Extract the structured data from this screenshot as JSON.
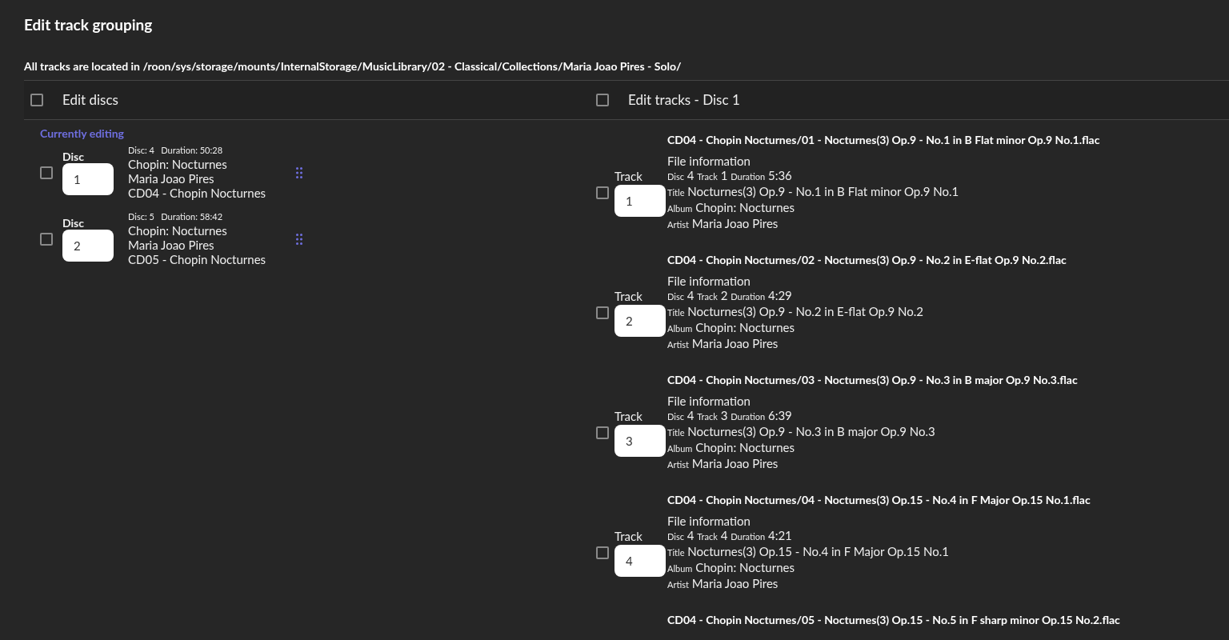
{
  "title": "Edit track grouping",
  "location": "All tracks are located in /roon/sys/storage/mounts/InternalStorage/MusicLibrary/02 - Classical/Collections/Maria Joao Pires - Solo/",
  "discs_panel": {
    "header": "Edit discs",
    "checked": false,
    "section_label": "Currently editing",
    "discs": [
      {
        "label": "Disc",
        "number": "1",
        "checked": false,
        "meta": "Disc: 4   Duration: 50:28",
        "lines": [
          "Chopin: Nocturnes",
          "Maria Joao Pires",
          "CD04 - Chopin Nocturnes"
        ]
      },
      {
        "label": "Disc",
        "number": "2",
        "checked": false,
        "meta": "Disc: 5   Duration: 58:42",
        "lines": [
          "Chopin: Nocturnes",
          "Maria Joao Pires",
          "CD05 - Chopin Nocturnes"
        ]
      }
    ]
  },
  "tracks_panel": {
    "header": "Edit tracks - Disc 1",
    "checked": false,
    "tracks": [
      {
        "path": "CD04 - Chopin Nocturnes/01 - Nocturnes(3) Op.9 - No.1 in B Flat minor Op.9 No.1.flac",
        "label": "Track",
        "number": "1",
        "checked": false,
        "info_title": "File information",
        "info": [
          [
            {
              "label": "Disc",
              "value": "4"
            },
            {
              "label": "Track",
              "value": "1"
            },
            {
              "label": "Duration",
              "value": "5:36"
            }
          ],
          [
            {
              "label": "Title",
              "value": "Nocturnes(3) Op.9 - No.1 in B Flat minor Op.9 No.1"
            }
          ],
          [
            {
              "label": "Album",
              "value": "Chopin: Nocturnes"
            }
          ],
          [
            {
              "label": "Artist",
              "value": "Maria Joao Pires"
            }
          ]
        ]
      },
      {
        "path": "CD04 - Chopin Nocturnes/02 - Nocturnes(3) Op.9 - No.2 in E-flat Op.9 No.2.flac",
        "label": "Track",
        "number": "2",
        "checked": false,
        "info_title": "File information",
        "info": [
          [
            {
              "label": "Disc",
              "value": "4"
            },
            {
              "label": "Track",
              "value": "2"
            },
            {
              "label": "Duration",
              "value": "4:29"
            }
          ],
          [
            {
              "label": "Title",
              "value": "Nocturnes(3) Op.9 - No.2 in E-flat Op.9 No.2"
            }
          ],
          [
            {
              "label": "Album",
              "value": "Chopin: Nocturnes"
            }
          ],
          [
            {
              "label": "Artist",
              "value": "Maria Joao Pires"
            }
          ]
        ]
      },
      {
        "path": "CD04 - Chopin Nocturnes/03 - Nocturnes(3) Op.9 - No.3 in B major Op.9 No.3.flac",
        "label": "Track",
        "number": "3",
        "checked": false,
        "info_title": "File information",
        "info": [
          [
            {
              "label": "Disc",
              "value": "4"
            },
            {
              "label": "Track",
              "value": "3"
            },
            {
              "label": "Duration",
              "value": "6:39"
            }
          ],
          [
            {
              "label": "Title",
              "value": "Nocturnes(3) Op.9 - No.3 in B major Op.9 No.3"
            }
          ],
          [
            {
              "label": "Album",
              "value": "Chopin: Nocturnes"
            }
          ],
          [
            {
              "label": "Artist",
              "value": "Maria Joao Pires"
            }
          ]
        ]
      },
      {
        "path": "CD04 - Chopin Nocturnes/04 - Nocturnes(3) Op.15 - No.4 in F Major Op.15 No.1.flac",
        "label": "Track",
        "number": "4",
        "checked": false,
        "info_title": "File information",
        "info": [
          [
            {
              "label": "Disc",
              "value": "4"
            },
            {
              "label": "Track",
              "value": "4"
            },
            {
              "label": "Duration",
              "value": "4:21"
            }
          ],
          [
            {
              "label": "Title",
              "value": "Nocturnes(3) Op.15 - No.4 in F Major Op.15 No.1"
            }
          ],
          [
            {
              "label": "Album",
              "value": "Chopin: Nocturnes"
            }
          ],
          [
            {
              "label": "Artist",
              "value": "Maria Joao Pires"
            }
          ]
        ]
      },
      {
        "path": "CD04 - Chopin Nocturnes/05 - Nocturnes(3) Op.15 - No.5 in F sharp minor Op.15 No.2.flac"
      }
    ]
  }
}
